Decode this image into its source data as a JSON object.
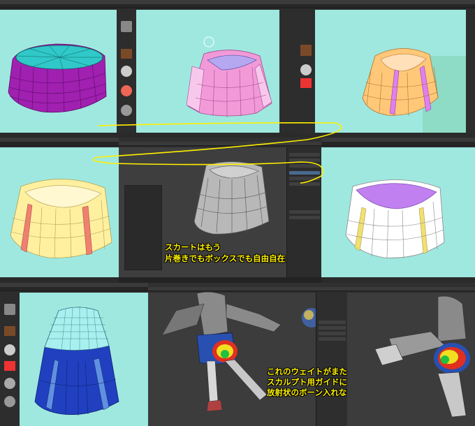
{
  "captions": {
    "middle": [
      "スカートはもう",
      "片巻きでもボックスでも自由自在♪"
    ],
    "bottom": [
      "これのウェイトがまた鬼門!",
      "スカルプト用ガイドにさえならないしっ!",
      "放射状のボーン入れないとムリだわ…"
    ]
  },
  "colors": {
    "viewport_bg": "#9fe8e0",
    "blender_bg": "#3e3e3e",
    "annotation": "#fff000",
    "skirt_purple": "#a020b0",
    "skirt_pink": "#f29ad8",
    "skirt_orange": "#ffc878",
    "skirt_yellow": "#fff0a0",
    "skirt_white": "#ffffff",
    "skirt_blue": "#2040c0"
  },
  "icons": [
    "sphere-brush-icon",
    "material-icon",
    "color-swatch-icon",
    "grid-icon"
  ]
}
